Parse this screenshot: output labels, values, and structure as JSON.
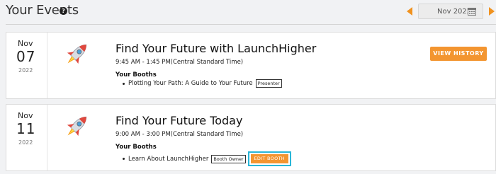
{
  "header": {
    "title": "Your Events",
    "help_icon": "question-circle-icon",
    "date_picker": {
      "value": "Nov 2022",
      "icon": "calendar-icon"
    },
    "prev_icon": "caret-left-icon",
    "next_icon": "caret-right-icon"
  },
  "colors": {
    "accent": "#f39530",
    "highlight": "#29b6d8",
    "background": "#f1f2f4",
    "card": "#ffffff"
  },
  "events": [
    {
      "month": "Nov",
      "day": "07",
      "year": "2022",
      "icon": "rocket-icon",
      "title": "Find Your Future with LaunchHigher",
      "time": "9:45 AM - 1:45 PM(Central Standard Time)",
      "booths_label": "Your Booths",
      "booths": [
        {
          "name": "Plotting Your Path: A Guide to Your Future",
          "role": "Presenter"
        }
      ],
      "action_label": "VIEW HISTORY"
    },
    {
      "month": "Nov",
      "day": "11",
      "year": "2022",
      "icon": "rocket-icon",
      "title": "Find Your Future Today",
      "time": "9:00 AM - 3:00 PM(Central Standard Time)",
      "booths_label": "Your Booths",
      "booths": [
        {
          "name": "Learn About LaunchHigher",
          "role": "Booth Owner",
          "action_label": "EDIT BOOTH"
        }
      ]
    }
  ]
}
